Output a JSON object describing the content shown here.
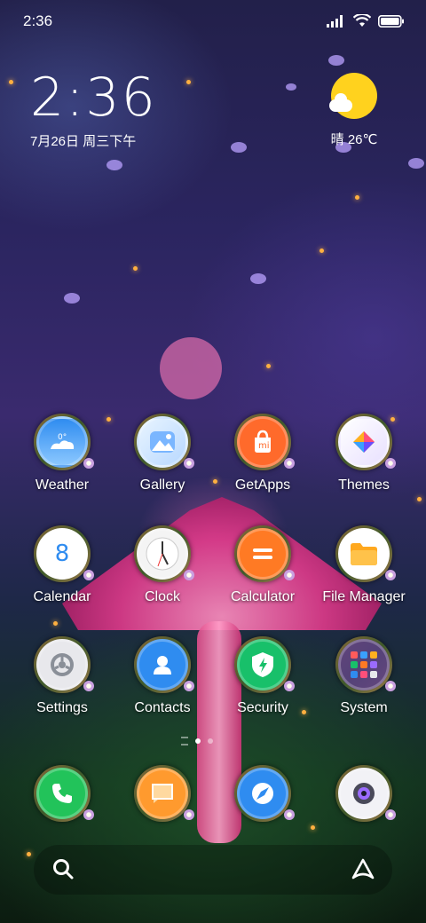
{
  "status_bar": {
    "time": "2:36"
  },
  "clock_widget": {
    "time": "2:36",
    "date": "7月26日 周三下午"
  },
  "weather_widget": {
    "condition": "晴",
    "temp": "26℃"
  },
  "apps": [
    {
      "label": "Weather",
      "icon": "weather-icon"
    },
    {
      "label": "Gallery",
      "icon": "gallery-icon"
    },
    {
      "label": "GetApps",
      "icon": "getapps-icon"
    },
    {
      "label": "Themes",
      "icon": "themes-icon"
    },
    {
      "label": "Calendar",
      "icon": "calendar-icon",
      "glyph": "8"
    },
    {
      "label": "Clock",
      "icon": "clock-icon"
    },
    {
      "label": "Calculator",
      "icon": "calculator-icon"
    },
    {
      "label": "File Manager",
      "icon": "file-manager-icon"
    },
    {
      "label": "Settings",
      "icon": "settings-icon"
    },
    {
      "label": "Contacts",
      "icon": "contacts-icon"
    },
    {
      "label": "Security",
      "icon": "security-icon"
    },
    {
      "label": "System",
      "icon": "system-folder-icon"
    }
  ],
  "dock": [
    {
      "icon": "phone-icon"
    },
    {
      "icon": "messages-icon"
    },
    {
      "icon": "browser-icon"
    },
    {
      "icon": "camera-icon"
    }
  ],
  "colors": {
    "sun": "#ffd21e",
    "weather_blue": "#2f8cf0",
    "getapps_orange": "#ff6a2b",
    "security_green": "#18c06a",
    "phone_green": "#22c35a"
  }
}
